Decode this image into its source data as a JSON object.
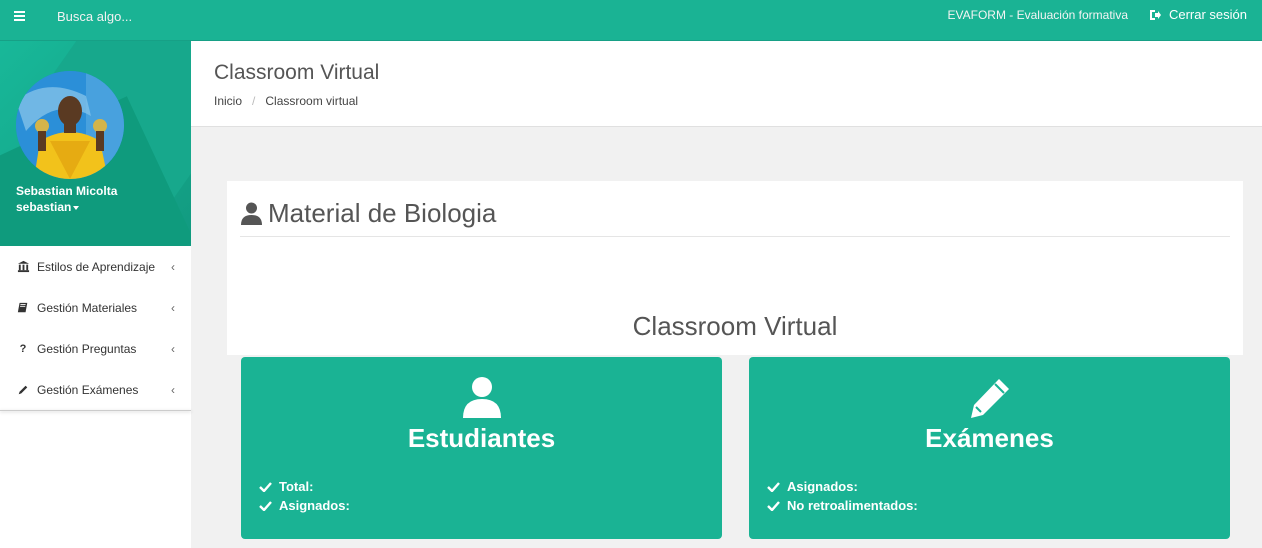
{
  "topbar": {
    "search_placeholder": "Busca algo...",
    "app_name": "EVAFORM - Evaluación formativa",
    "logout_label": "Cerrar sesión"
  },
  "sidebar": {
    "profile": {
      "name": "Sebastian Micolta",
      "username": "sebastian"
    },
    "items": [
      {
        "label": "Estilos de Aprendizaje",
        "icon": "bank-icon"
      },
      {
        "label": "Gestión Materiales",
        "icon": "book-icon"
      },
      {
        "label": "Gestión Preguntas",
        "icon": "question-icon"
      },
      {
        "label": "Gestión Exámenes",
        "icon": "pencil-icon"
      }
    ]
  },
  "header": {
    "title": "Classroom Virtual",
    "breadcrumb": [
      "Inicio",
      "Classroom virtual"
    ],
    "breadcrumb_separator": "/"
  },
  "panel": {
    "title": "Material de Biologia",
    "heading": "Classroom Virtual"
  },
  "cards": {
    "students": {
      "title": "Estudiantes",
      "items": [
        "Total:",
        "Asignados:"
      ]
    },
    "exams": {
      "title": "Exámenes",
      "items": [
        "Asignados:",
        "No retroalimentados:"
      ]
    }
  },
  "colors": {
    "accent": "#1ab394",
    "background": "#f1f1f1"
  }
}
